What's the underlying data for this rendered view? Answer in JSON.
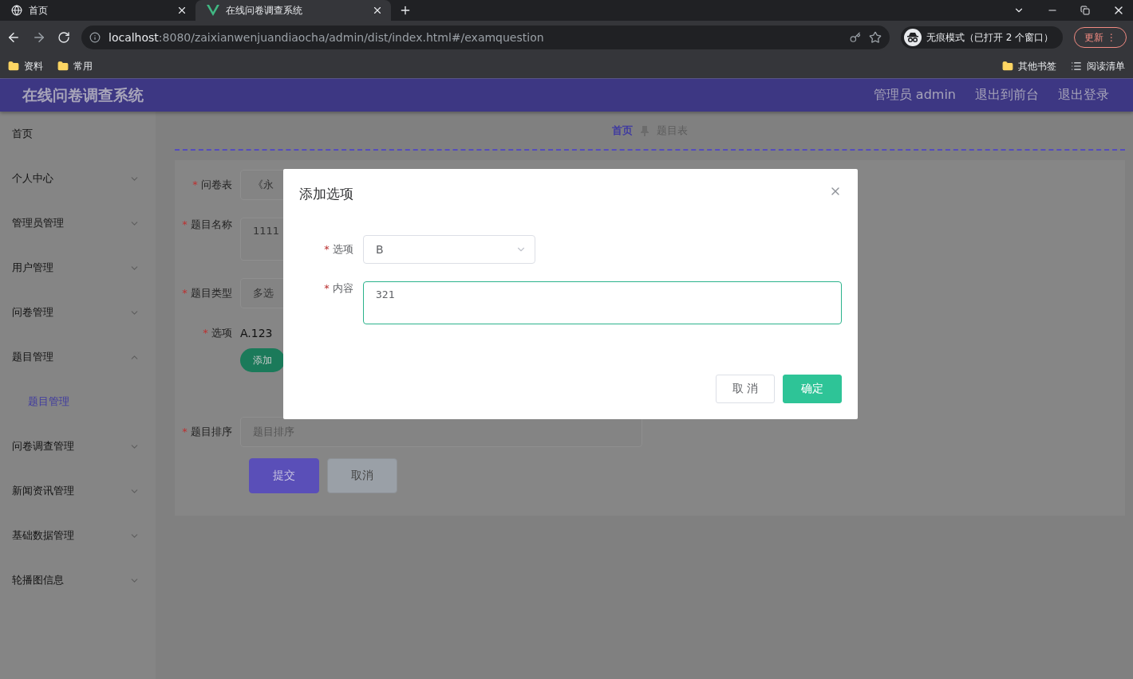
{
  "browser": {
    "tabs": [
      {
        "title": "首页",
        "selected": false
      },
      {
        "title": "在线问卷调查系统",
        "selected": true
      }
    ],
    "url": {
      "host": "localhost",
      "rest": ":8080/zaixianwenjuandiaocha/admin/dist/index.html#/examquestion"
    },
    "incognito": "无痕模式（已打开 2 个窗口）",
    "update": "更新",
    "menu": "⋮",
    "bookmarks": [
      "资料",
      "常用"
    ],
    "other_bookmarks": "其他书签",
    "reading_list": "阅读清单"
  },
  "header": {
    "title": "在线问卷调查系统",
    "links": [
      "管理员 admin",
      "退出到前台",
      "退出登录"
    ]
  },
  "sidebar": {
    "items": [
      {
        "label": "首页"
      },
      {
        "label": "个人中心",
        "expanded": false
      },
      {
        "label": "管理员管理",
        "expanded": false
      },
      {
        "label": "用户管理",
        "expanded": false
      },
      {
        "label": "问卷管理",
        "expanded": false
      },
      {
        "label": "题目管理",
        "expanded": true,
        "children": [
          {
            "label": "题目管理",
            "selected": true
          }
        ]
      },
      {
        "label": "问卷调查管理",
        "expanded": false
      },
      {
        "label": "新闻资讯管理",
        "expanded": false
      },
      {
        "label": "基础数据管理",
        "expanded": false
      },
      {
        "label": "轮播图信息",
        "expanded": false
      }
    ]
  },
  "breadcrumb": [
    {
      "label": "首页",
      "selected": true
    },
    {
      "label": "题目表",
      "selected": false
    }
  ],
  "form": {
    "fields": [
      {
        "req": "*",
        "label": "问卷表",
        "kind": "select",
        "value": "《永"
      },
      {
        "req": "*",
        "label": "题目名称",
        "kind": "textarea",
        "value": "1111"
      },
      {
        "req": "*",
        "label": "题目类型",
        "kind": "select",
        "value": "多选"
      },
      {
        "req": "*",
        "label": "选项",
        "kind": "options",
        "value": "A.123",
        "button": "添加"
      },
      {
        "req": "*",
        "label": "题目排序",
        "kind": "input",
        "placeholder": "题目排序"
      }
    ],
    "buttons": [
      {
        "label": "提交",
        "kind": "primary"
      },
      {
        "label": "取消",
        "kind": "secondary"
      }
    ]
  },
  "modal": {
    "title": "添加选项",
    "fields": [
      {
        "req": "*",
        "label": "选项",
        "kind": "select",
        "value": "B"
      },
      {
        "req": "*",
        "label": "内容",
        "kind": "textarea",
        "value": "321"
      }
    ],
    "buttons": [
      {
        "label": "取 消",
        "kind": "secondary"
      },
      {
        "label": "确定",
        "kind": "primary"
      }
    ]
  }
}
